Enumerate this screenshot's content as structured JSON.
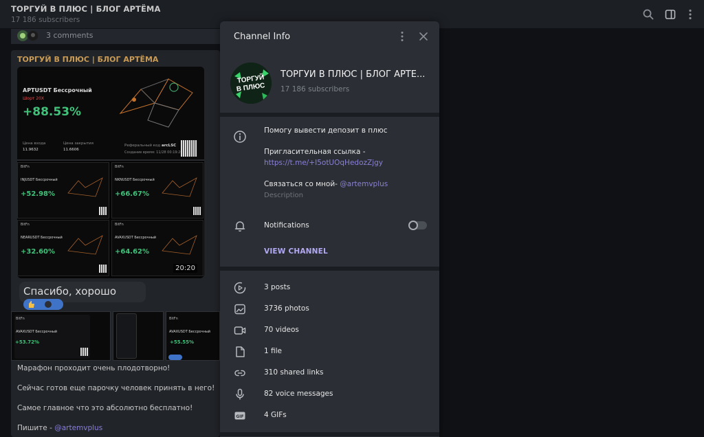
{
  "header": {
    "title": "ТОРГУЙ В ПЛЮС | БЛОГ АРТЁМА",
    "subtitle": "17 186 subscribers"
  },
  "chat": {
    "comments_label": "3 comments",
    "post_author": "ТОРГУЙ В ПЛЮС | БЛОГ АРТЁМА",
    "big_card": {
      "pair": "APTUSDT Бессрочный",
      "tag": "Шорт 20X",
      "percent": "+88.53%",
      "entry_label": "Цена входа",
      "entry_value": "11.9632",
      "close_label": "Цена закрытия",
      "close_value": "11.6606",
      "ref_label": "Реферальный код",
      "ref_code": "arcLSC",
      "time_note": "Создание время: 11/28 00:19:26"
    },
    "mini_cards": [
      {
        "header": "BitFn",
        "pair": "INJUSDT Бессрочный",
        "percent": "+52.98%"
      },
      {
        "header": "BitFn",
        "pair": "NKNUSDT Бессрочный",
        "percent": "+66.67%"
      },
      {
        "header": "BitFn",
        "pair": "NEARUSDT Бессрочный",
        "percent": "+32.60%"
      },
      {
        "header": "BitFn",
        "pair": "AVAXUSDT Бессрочный",
        "percent": "+64.62%"
      }
    ],
    "image_time": "20:20",
    "reply_text": "Спасибо, хорошо идем!",
    "thumbs": [
      {
        "header": "BitFn",
        "pair": "AVAXUSDT Бессрочный",
        "percent": "+53.72%"
      },
      {
        "header": "",
        "pair": "",
        "percent": ""
      },
      {
        "header": "BitFn",
        "pair": "AVAXUSDT Бессрочный",
        "percent": "+55.55%"
      }
    ],
    "lines": [
      "Марафон проходит очень плодотворно!",
      "Сейчас готов еще парочку человек принять  в него!",
      "Самое главное что это абсолютно бесплатно!"
    ],
    "write_prefix": "Пишите - ",
    "write_link": "@artemvplus"
  },
  "panel": {
    "title": "Channel Info",
    "channel_name": "ТОРГУЙ В ПЛЮС | БЛОГ АРТЁ...",
    "subscribers": "17 186 subscribers",
    "avatar_text": [
      "ТОРГУЙ",
      "В ПЛЮС"
    ],
    "description_line": "Помогу вывести депозит в плюс",
    "invite_label": "Пригласительная ссылка -",
    "invite_link": "https://t.me/+I5otUOqHedozZjgy",
    "contact_prefix": "Связаться со мной- ",
    "contact_link": "@artemvplus",
    "description_caption": "Description",
    "notifications_label": "Notifications",
    "notifications_on": false,
    "view_channel": "VIEW CHANNEL",
    "stats": [
      {
        "icon": "posts-icon",
        "label": "3 posts"
      },
      {
        "icon": "photos-icon",
        "label": "3736 photos"
      },
      {
        "icon": "videos-icon",
        "label": "70 videos"
      },
      {
        "icon": "file-icon",
        "label": "1 file"
      },
      {
        "icon": "link-icon",
        "label": "310 shared links"
      },
      {
        "icon": "microphone-icon",
        "label": "82 voice messages"
      },
      {
        "icon": "gif-icon",
        "label": "4 GIFs"
      }
    ]
  },
  "colors": {
    "accent_link": "#8a7fd6",
    "view_channel": "#b3a9f2",
    "author": "#c99b54",
    "profit_green": "#41c27a"
  }
}
